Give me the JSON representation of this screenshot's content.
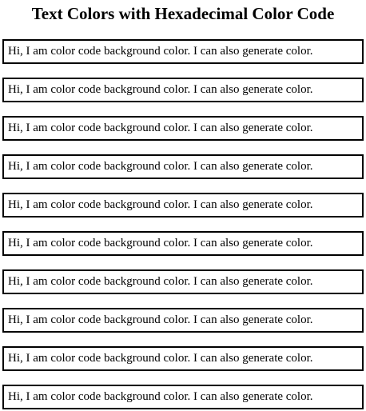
{
  "page": {
    "title": "Text Colors with Hexadecimal Color Code"
  },
  "boxes": [
    {
      "text": "Hi, I am color code background color. I can also generate color.",
      "text_color": "#000000"
    },
    {
      "text": "Hi, I am color code background color. I can also generate color.",
      "text_color": "#000000"
    },
    {
      "text": "Hi, I am color code background color. I can also generate color.",
      "text_color": "#000000"
    },
    {
      "text": "Hi, I am color code background color. I can also generate color.",
      "text_color": "#000000"
    },
    {
      "text": "Hi, I am color code background color. I can also generate color.",
      "text_color": "#000000"
    },
    {
      "text": "Hi, I am color code background color. I can also generate color.",
      "text_color": "#000000"
    },
    {
      "text": "Hi, I am color code background color. I can also generate color.",
      "text_color": "#000000"
    },
    {
      "text": "Hi, I am color code background color. I can also generate color.",
      "text_color": "#000000"
    },
    {
      "text": "Hi, I am color code background color. I can also generate color.",
      "text_color": "#000000"
    },
    {
      "text": "Hi, I am color code background color. I can also generate color.",
      "text_color": "#000000"
    }
  ]
}
